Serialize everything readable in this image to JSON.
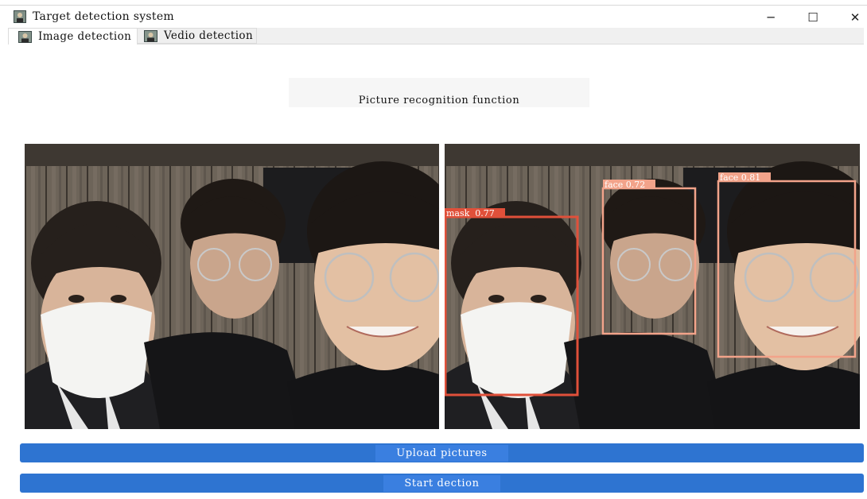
{
  "window": {
    "title": "Target detection system",
    "minimize": "─",
    "maximize": "☐",
    "close": "✕"
  },
  "tabs": [
    {
      "label": "Image detection",
      "active": true
    },
    {
      "label": "Vedio detection",
      "active": false
    }
  ],
  "main": {
    "title": "Picture recognition function",
    "detections": [
      {
        "label": "mask  0.77",
        "color": "#e0503a"
      },
      {
        "label": "face 0.72",
        "color": "#f2a38a"
      },
      {
        "label": "face 0.81",
        "color": "#f2a38a"
      }
    ]
  },
  "buttons": {
    "upload": "Upload pictures",
    "start": "Start dection"
  },
  "colors": {
    "button": "#2e74d1",
    "mask_box": "#e0503a",
    "face_box": "#f2a38a"
  }
}
